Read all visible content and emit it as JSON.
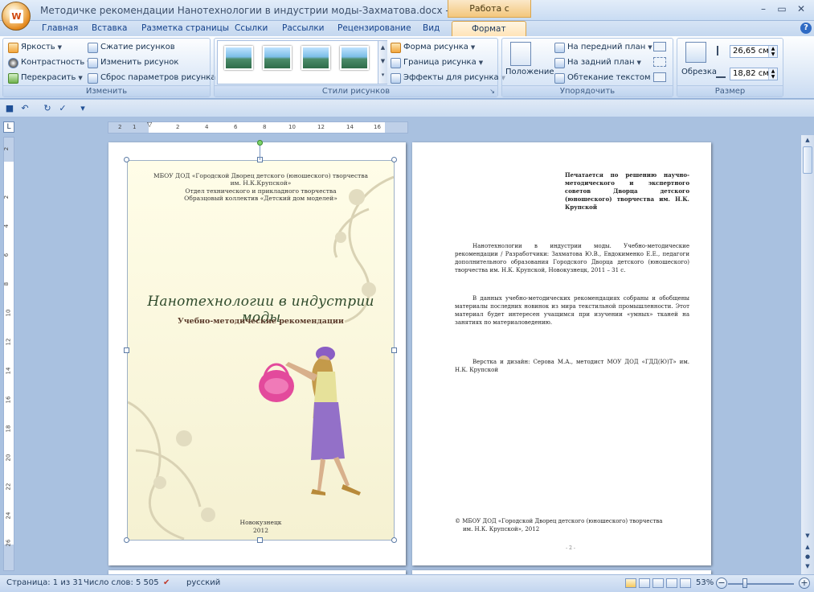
{
  "window": {
    "title": "Методичке рекомендации Нанотехнологии в индустрии моды-Захматова.docx - Microsoft ...",
    "context_tab": "Работа с рисунками",
    "minimize": "–",
    "maximize": "▭",
    "close": "✕",
    "office_logo": "W"
  },
  "tabs": [
    "Главная",
    "Вставка",
    "Разметка страницы",
    "Ссылки",
    "Рассылки",
    "Рецензирование",
    "Вид",
    "Формат"
  ],
  "ribbon": {
    "adjust": {
      "label": "Изменить",
      "brightness": "Яркость",
      "contrast": "Контрастность",
      "recolor": "Перекрасить",
      "compress": "Сжатие рисунков",
      "change": "Изменить рисунок",
      "reset": "Сброс параметров рисунка"
    },
    "styles": {
      "label": "Стили рисунков",
      "shape": "Форма рисунка",
      "border": "Граница рисунка",
      "effects": "Эффекты для рисунка"
    },
    "arrange": {
      "label": "Упорядочить",
      "position": "Положение",
      "front": "На передний план",
      "back": "На задний план",
      "wrap": "Обтекание текстом"
    },
    "size": {
      "label": "Размер",
      "crop": "Обрезка",
      "height": "26,65 см",
      "width": "18,82 см"
    }
  },
  "ruler": {
    "h_ticks": [
      "2",
      "1",
      "2",
      "4",
      "6",
      "8",
      "10",
      "12",
      "14",
      "16"
    ],
    "v_ticks": [
      "2",
      "2",
      "4",
      "6",
      "8",
      "10",
      "12",
      "14",
      "16",
      "18",
      "20",
      "22",
      "24",
      "26"
    ]
  },
  "page1": {
    "header_lines": [
      "МБОУ ДОД «Городской Дворец детского (юношеского) творчества",
      "им. Н.К.Крупской»",
      "Отдел технического и прикладного творчества",
      "Образцовый коллектив «Детский дом моделей»"
    ],
    "title": "Нанотехнологии в индустрии моды",
    "subtitle": "Учебно-методические рекомендации",
    "city": "Новокузнецк",
    "year": "2012"
  },
  "page2": {
    "top_note": "Печатается по решению научно-методического и экспертного советов Дворца детского (юношеского) творчества им. Н.К. Крупской",
    "para1": "Нанотехнологии в индустрии моды. Учебно-методические рекомендации / Разработчики: Захматова Ю.В., Евдокименко Е.Е., педагоги дополнительного образования Городского Дворца детского (юношеского) творчества им. Н.К. Крупской, Новокузнецк, 2011 – 31 с.",
    "para2": "В данных учебно-методических рекомендациях собраны и обобщены материалы последних новинок из мира текстильной промышленности. Этот материал будет интересен учащимся при изучении «умных» тканей на занятиях по материаловедению.",
    "para3": "Верстка и дизайн: Серова М.А., методист МОУ ДОД «ГДД(Ю)Т» им. Н.К. Крупской",
    "copyright1": "© МБОУ ДОД «Городской Дворец детского (юношеского) творчества",
    "copyright2": "им. Н.К. Крупской», 2012",
    "page_num": "- 2 -"
  },
  "status": {
    "page": "Страница: 1 из 31",
    "words": "Число слов: 5 505",
    "language": "русский",
    "zoom": "53%"
  }
}
